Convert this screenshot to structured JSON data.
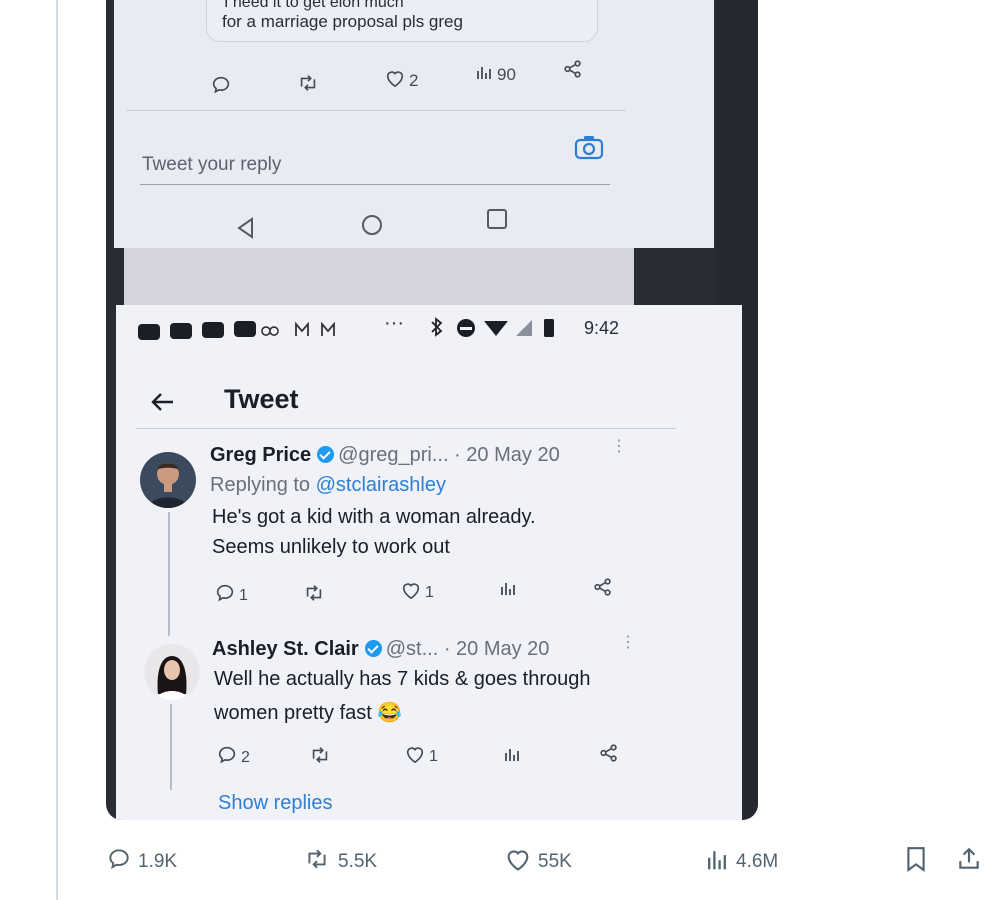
{
  "quoted": {
    "line1": "I need it to get elon much",
    "line2": "for a marriage proposal pls greg"
  },
  "top_actions": {
    "likes": "2",
    "views": "90"
  },
  "reply_prompt": "Tweet your reply",
  "status_bar": {
    "time": "9:42"
  },
  "header": {
    "title": "Tweet"
  },
  "tweet1": {
    "name": "Greg Price",
    "handle": "@greg_pri...",
    "date": "· 20 May 20",
    "reply_prefix": "Replying to ",
    "reply_to": "@stclairashley",
    "text_line1": "He's got a kid with a woman already.",
    "text_line2": "Seems unlikely to work out",
    "replies": "1",
    "likes": "1"
  },
  "tweet2": {
    "name": "Ashley St. Clair",
    "handle": "@st...",
    "date": "· 20 May 20",
    "text_line1": "Well he actually has 7 kids & goes through",
    "text_line2": "women pretty fast",
    "emoji": "😂",
    "replies": "2",
    "likes": "1"
  },
  "show_replies": "Show replies",
  "stats": {
    "replies": "1.9K",
    "retweets": "5.5K",
    "likes": "55K",
    "views": "4.6M"
  },
  "colors": {
    "accent": "#1d9bf0",
    "link": "#2e7fd3",
    "muted": "#536471"
  }
}
